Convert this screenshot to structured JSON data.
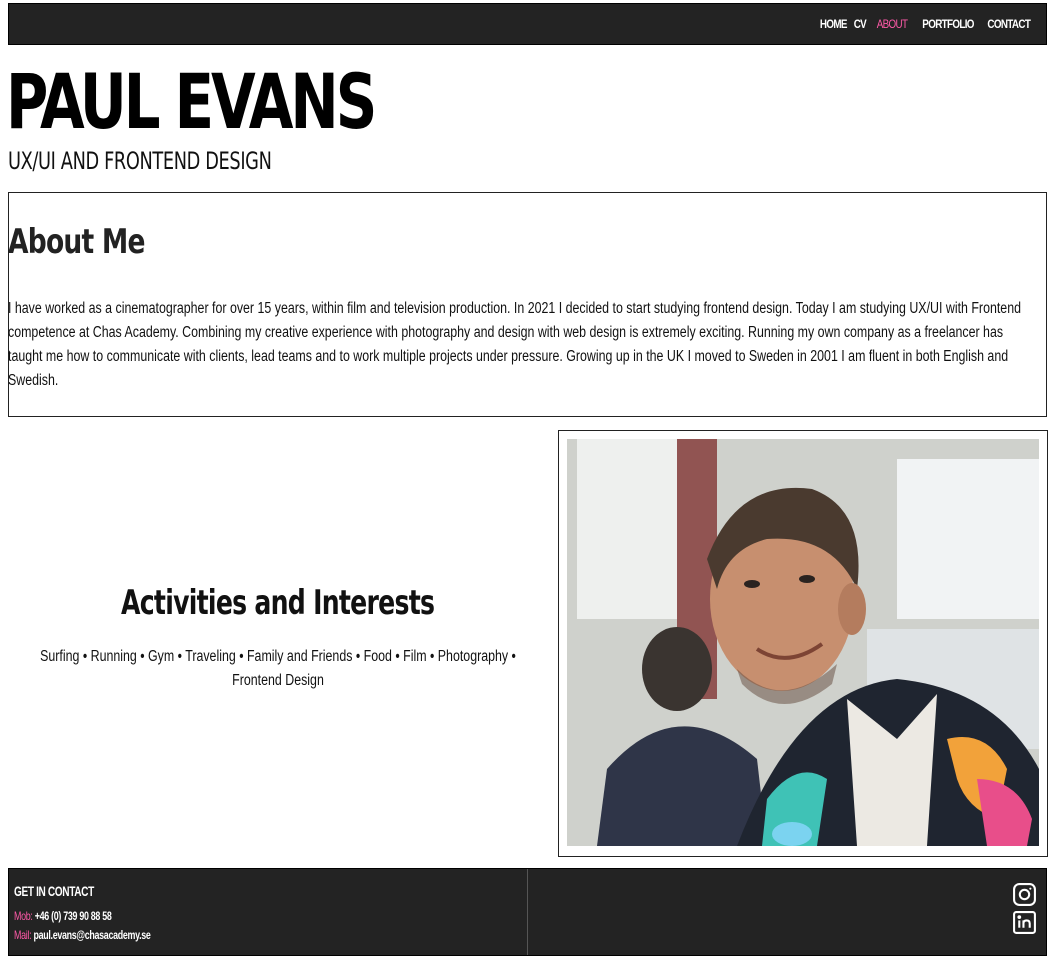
{
  "nav": {
    "items": [
      {
        "label": "HOME",
        "active": false
      },
      {
        "label": "CV",
        "active": false
      },
      {
        "label": "ABOUT",
        "active": true
      },
      {
        "label": "PORTFOLIO",
        "active": false
      },
      {
        "label": "CONTACT",
        "active": false
      }
    ]
  },
  "hero": {
    "name": "PAUL EVANS",
    "subtitle": "UX/UI AND FRONTEND DESIGN"
  },
  "about": {
    "title": "About Me",
    "text": "I have worked as a cinematographer for over 15 years, within film and television production. In 2021 I decided to start studying frontend design. Today I am studying UX/UI with Frontend competence at Chas Academy. Combining my creative experience with photography and design with web design is extremely exciting. Running my own company as a freelancer has taught me how to communicate with clients, lead teams and to work multiple projects under pressure. Growing up in the UK I moved to Sweden in 2001 I am fluent in both English and Swedish."
  },
  "interests": {
    "title": "Activities and Interests",
    "list": "Surfing • Running • Gym • Traveling • Family and Friends • Food • Film • Photography • Frontend Design"
  },
  "photo": {
    "subject": "portrait-photo"
  },
  "footer": {
    "title": "GET IN CONTACT",
    "mob_label": "Mob:",
    "mob_value": "+46 (0) 739 90 88 58",
    "mail_label": "Mail:",
    "mail_value": "paul.evans@chasacademy.se",
    "icons": [
      "instagram-icon",
      "linkedin-icon"
    ]
  },
  "colors": {
    "nav_bg": "#232323",
    "accent_pink": "#ff5aa8",
    "footer_bg": "#232323"
  }
}
